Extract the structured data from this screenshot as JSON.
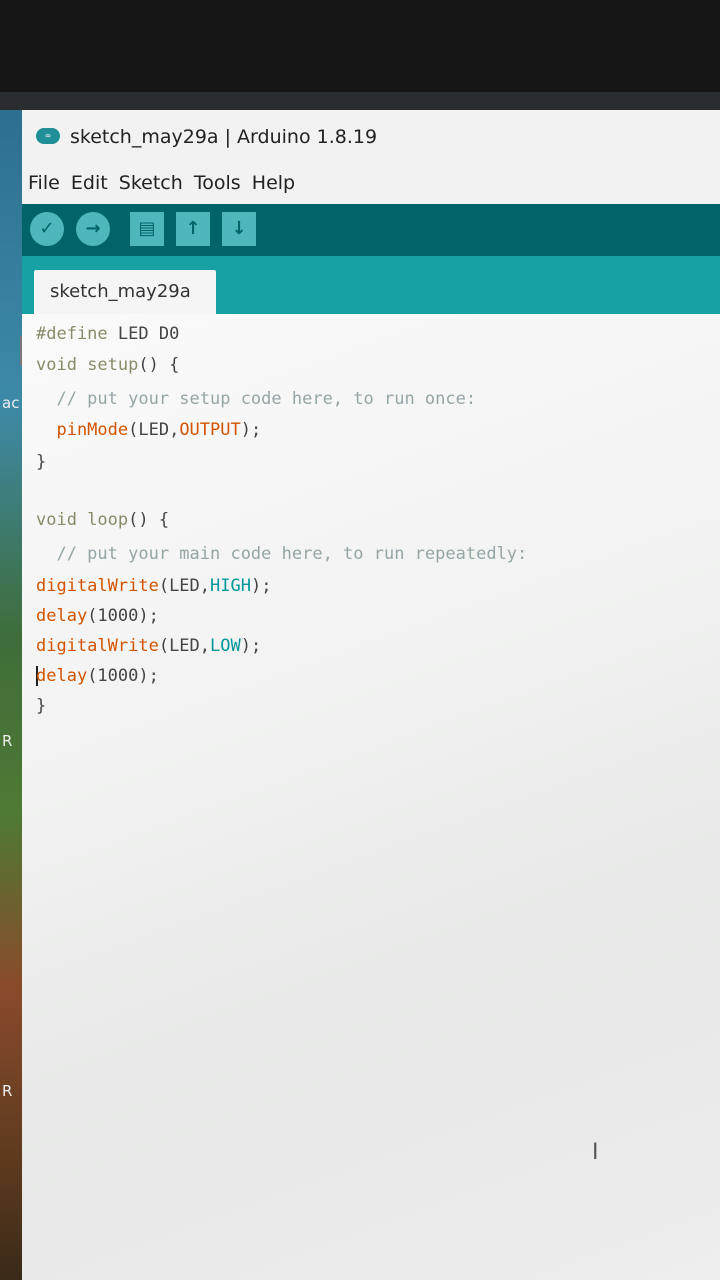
{
  "window": {
    "title": "sketch_may29a | Arduino 1.8.19",
    "app_logo": "∞"
  },
  "menu": {
    "items": [
      "File",
      "Edit",
      "Sketch",
      "Tools",
      "Help"
    ]
  },
  "toolbar": {
    "verify_icon": "✓",
    "upload_icon": "→",
    "new_icon": "▤",
    "open_icon": "↑",
    "save_icon": "↓"
  },
  "tab": {
    "label": "sketch_may29a"
  },
  "desktop": {
    "edge_text_1": "ac",
    "edge_text_2": "R",
    "edge_text_3": "R"
  },
  "code": {
    "l1_a": "#define",
    "l1_b": " LED D0",
    "l2_a": "void",
    "l2_b": " setup",
    "l2_c": "() {",
    "l3": "  // put your setup code here, to run once:",
    "l4_a": "  pinMode",
    "l4_b": "(LED,",
    "l4_c": "OUTPUT",
    "l4_d": ");",
    "l5": "}",
    "l7_a": "void",
    "l7_b": " loop",
    "l7_c": "() {",
    "l8": "  // put your main code here, to run repeatedly:",
    "l9_a": "digitalWrite",
    "l9_b": "(LED,",
    "l9_c": "HIGH",
    "l9_d": ");",
    "l10_a": "delay",
    "l10_b": "(1000);",
    "l11_a": "digitalWrite",
    "l11_b": "(LED,",
    "l11_c": "LOW",
    "l11_d": ");",
    "l12_a": "delay",
    "l12_b": "(1000);",
    "l13": "}"
  },
  "colors": {
    "toolbar": "#006468",
    "tabstrip": "#17a1a5",
    "button": "#4db7bb",
    "keyword": "#8a8a6a",
    "function": "#d35400",
    "constant": "#00979c"
  }
}
